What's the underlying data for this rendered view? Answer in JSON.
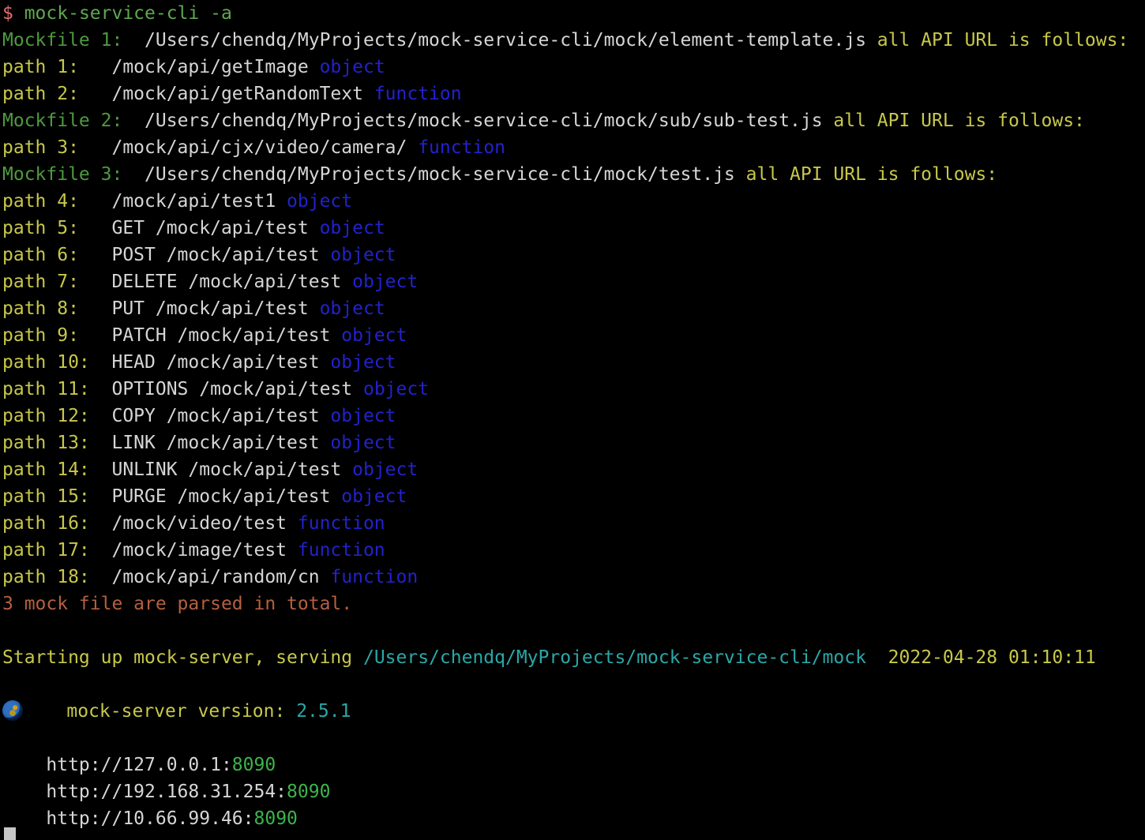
{
  "terminal": {
    "background_color": "#000000",
    "default_text_color": "#d6d6d6",
    "prompt_symbol": "$",
    "command": "mock-service-cli -a",
    "cursor": {
      "name": "block-cursor",
      "color": "#c6c6c6"
    }
  },
  "colors": {
    "prompt": "#e36d6d",
    "command": "#5fa84f",
    "mockfile_label": "#4e9a3f",
    "path_label": "#c8c84a",
    "type_keyword": "#2222cc",
    "summary": "#b5603f",
    "cyan": "#2aa8a8",
    "yellow": "#c8c84a",
    "green_port": "#3cb44b",
    "white": "#d6d6d6"
  },
  "mockfiles": [
    {
      "label": "Mockfile 1:",
      "file": "/Users/chendq/MyProjects/mock-service-cli/mock/element-template.js",
      "suffix": "all API URL is follows:",
      "paths": [
        {
          "label": "path 1:",
          "method": "",
          "url": "/mock/api/getImage",
          "type": "object"
        },
        {
          "label": "path 2:",
          "method": "",
          "url": "/mock/api/getRandomText",
          "type": "function"
        }
      ]
    },
    {
      "label": "Mockfile 2:",
      "file": "/Users/chendq/MyProjects/mock-service-cli/mock/sub/sub-test.js",
      "suffix": "all API URL is follows:",
      "paths": [
        {
          "label": "path 3:",
          "method": "",
          "url": "/mock/api/cjx/video/camera/",
          "type": "function"
        }
      ]
    },
    {
      "label": "Mockfile 3:",
      "file": "/Users/chendq/MyProjects/mock-service-cli/mock/test.js",
      "suffix": "all API URL is follows:",
      "paths": [
        {
          "label": "path 4:",
          "method": "",
          "url": "/mock/api/test1",
          "type": "object"
        },
        {
          "label": "path 5:",
          "method": "GET",
          "url": "/mock/api/test",
          "type": "object"
        },
        {
          "label": "path 6:",
          "method": "POST",
          "url": "/mock/api/test",
          "type": "object"
        },
        {
          "label": "path 7:",
          "method": "DELETE",
          "url": "/mock/api/test",
          "type": "object"
        },
        {
          "label": "path 8:",
          "method": "PUT",
          "url": "/mock/api/test",
          "type": "object"
        },
        {
          "label": "path 9:",
          "method": "PATCH",
          "url": "/mock/api/test",
          "type": "object"
        },
        {
          "label": "path 10:",
          "method": "HEAD",
          "url": "/mock/api/test",
          "type": "object"
        },
        {
          "label": "path 11:",
          "method": "OPTIONS",
          "url": "/mock/api/test",
          "type": "object"
        },
        {
          "label": "path 12:",
          "method": "COPY",
          "url": "/mock/api/test",
          "type": "object"
        },
        {
          "label": "path 13:",
          "method": "LINK",
          "url": "/mock/api/test",
          "type": "object"
        },
        {
          "label": "path 14:",
          "method": "UNLINK",
          "url": "/mock/api/test",
          "type": "object"
        },
        {
          "label": "path 15:",
          "method": "PURGE",
          "url": "/mock/api/test",
          "type": "object"
        },
        {
          "label": "path 16:",
          "method": "",
          "url": "/mock/video/test",
          "type": "function"
        },
        {
          "label": "path 17:",
          "method": "",
          "url": "/mock/image/test",
          "type": "function"
        },
        {
          "label": "path 18:",
          "method": "",
          "url": "/mock/api/random/cn",
          "type": "function"
        }
      ]
    }
  ],
  "summary": "3 mock file are parsed in total.",
  "startup": {
    "label": "Starting up mock-server, serving",
    "path": "/Users/chendq/MyProjects/mock-service-cli/mock",
    "timestamp": "2022-04-28 01:10:11"
  },
  "version": {
    "icon": "globe-icon",
    "label": "mock-server version:",
    "value": "2.5.1"
  },
  "urls": [
    {
      "host": "http://127.0.0.1:",
      "port": "8090"
    },
    {
      "host": "http://192.168.31.254:",
      "port": "8090"
    },
    {
      "host": "http://10.66.99.46:",
      "port": "8090"
    }
  ]
}
